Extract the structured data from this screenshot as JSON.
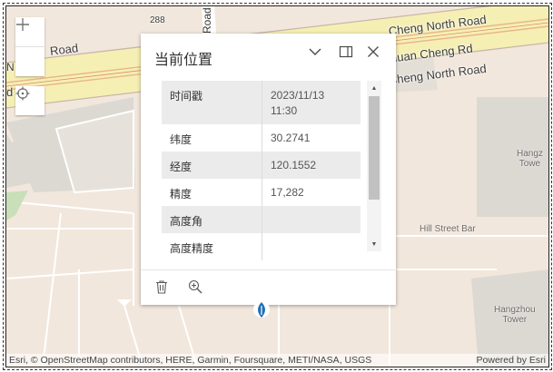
{
  "map": {
    "road_labels": {
      "north_road": "Road",
      "north_road_prefix": "N",
      "d_fragment": "d",
      "cheng_north_road_1": "Cheng North Road",
      "huan_cheng_rd": "Huan Cheng Rd",
      "cheng_north_road_2": "Cheng North Road",
      "shield_288": "288",
      "road_vertical": "Road"
    },
    "poi_labels": {
      "hill_street_bar": "Hill Street Bar",
      "hangzhou_tower_top": "Hangz\nTowe",
      "hangzhou_tower": "Hangzhou\nTower"
    },
    "attribution": "Esri, © OpenStreetMap contributors, HERE, Garmin, Foursquare, METI/NASA, USGS",
    "powered_by": "Powered by Esri"
  },
  "controls": {
    "zoom_in": "+",
    "zoom_out": "−"
  },
  "popup": {
    "title": "当前位置",
    "fields": [
      {
        "key": "时间戳",
        "value": "2023/11/13 11:30"
      },
      {
        "key": "纬度",
        "value": "30.2741"
      },
      {
        "key": "经度",
        "value": "120.1552"
      },
      {
        "key": "精度",
        "value": "17,282"
      },
      {
        "key": "高度角",
        "value": ""
      },
      {
        "key": "高度精度",
        "value": ""
      }
    ],
    "scroll": {
      "up": "▲",
      "down": "▼"
    }
  },
  "colors": {
    "map_background": "#f2e7dc",
    "major_road": "#f6efb4",
    "building": "#dcd9d3",
    "park": "#c8dfba",
    "marker": "#1f6fb5"
  }
}
